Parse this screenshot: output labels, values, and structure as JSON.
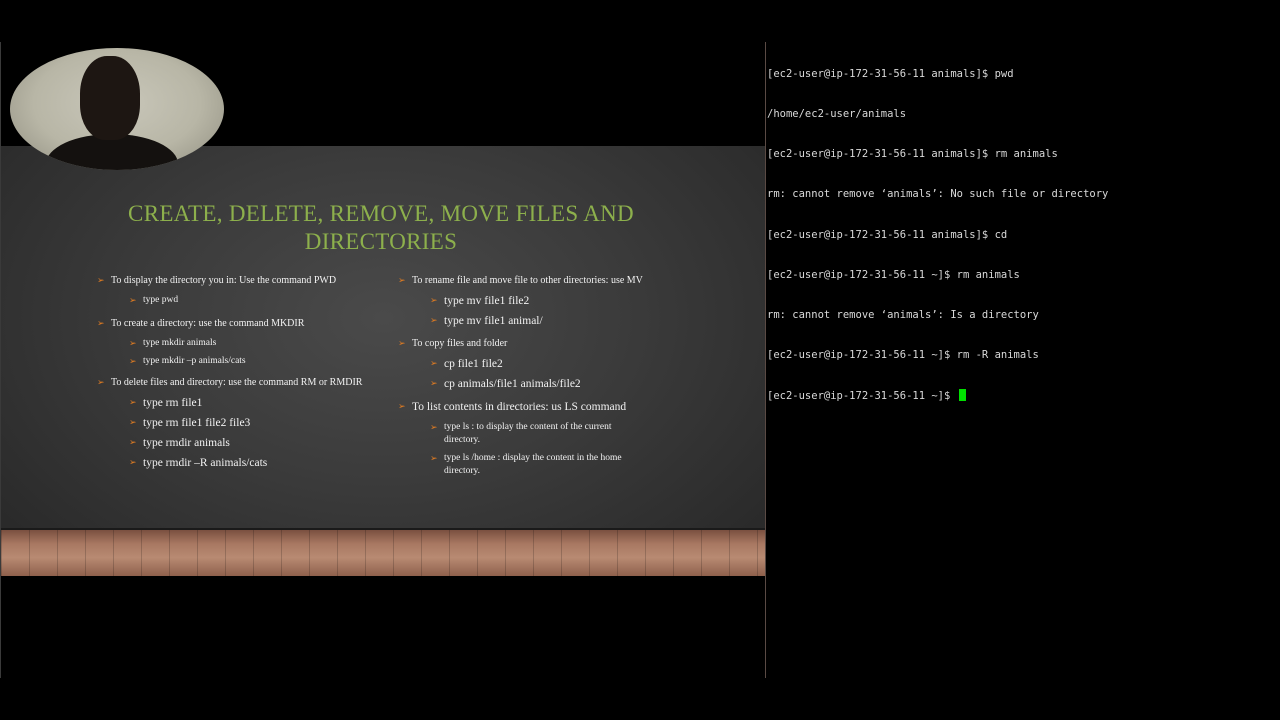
{
  "slide": {
    "title": "CREATE, DELETE, REMOVE, MOVE FILES AND DIRECTORIES",
    "colors": {
      "title": "#8db04c",
      "bullet_arrow": "#e07c22",
      "text": "#f2f2f2"
    },
    "left_column": [
      {
        "text": "To display the directory you in:  Use the command PWD",
        "sub": [
          "type pwd"
        ]
      },
      {
        "text": "To create a directory: use the command MKDIR",
        "sub": [
          "type mkdir animals",
          "type mkdir –p animals/cats"
        ]
      },
      {
        "text": "To delete files and directory: use the command RM or RMDIR",
        "sub": [
          "type rm file1",
          "type rm file1 file2 file3",
          "type rmdir animals",
          "type rmdir –R  animals/cats"
        ]
      }
    ],
    "right_column": [
      {
        "text": "To rename file  and move file to other directories: use MV",
        "sub": [
          "type mv file1 file2",
          "type mv file1  animal/"
        ]
      },
      {
        "text": "To copy files and folder",
        "sub": [
          " cp file1 file2",
          "cp animals/file1 animals/file2"
        ]
      },
      {
        "text": "To list contents in directories: us LS command",
        "sub": [
          "type ls :  to display the content of the current directory.",
          "type ls /home : display the content in the home directory."
        ]
      }
    ]
  },
  "webcam": {
    "icon": "person-video-feed"
  },
  "terminal": {
    "cursor_color": "#00e000",
    "lines": [
      "[ec2-user@ip-172-31-56-11 animals]$ pwd",
      "/home/ec2-user/animals",
      "[ec2-user@ip-172-31-56-11 animals]$ rm animals",
      "rm: cannot remove ‘animals’: No such file or directory",
      "[ec2-user@ip-172-31-56-11 animals]$ cd",
      "[ec2-user@ip-172-31-56-11 ~]$ rm animals",
      "rm: cannot remove ‘animals’: Is a directory",
      "[ec2-user@ip-172-31-56-11 ~]$ rm -R animals",
      "[ec2-user@ip-172-31-56-11 ~]$ "
    ]
  }
}
